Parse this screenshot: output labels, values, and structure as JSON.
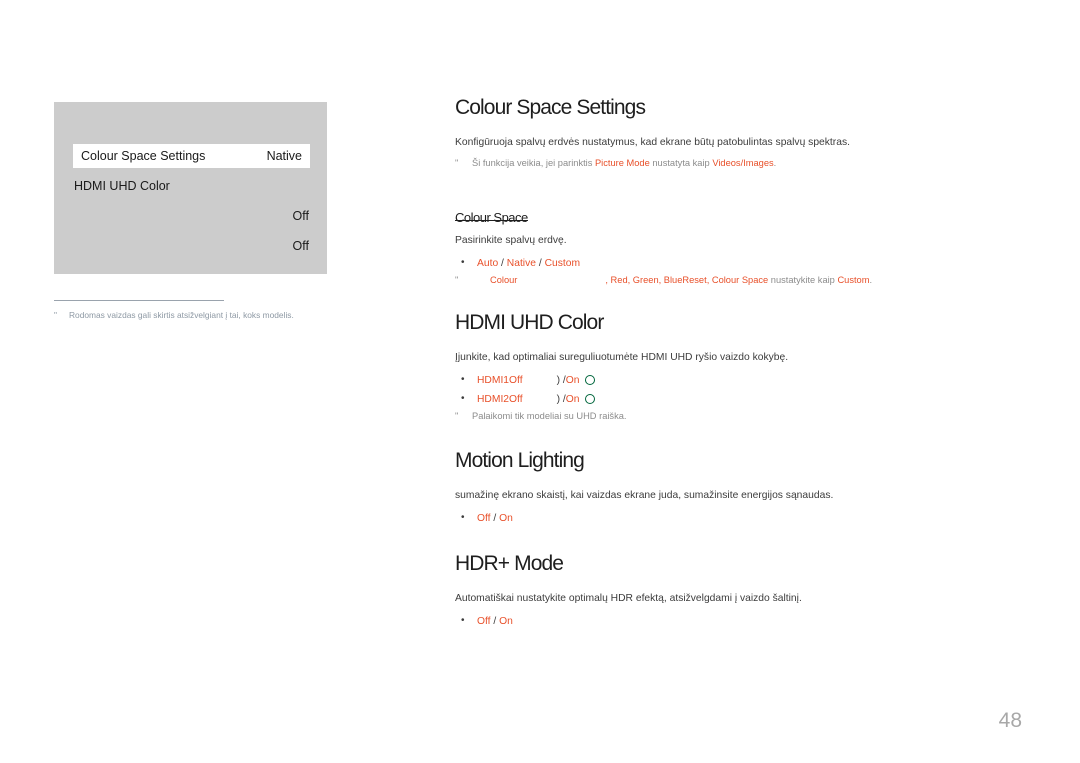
{
  "osd": {
    "rows": [
      {
        "label": "Colour Space Settings",
        "value": "Native",
        "highlight": true
      },
      {
        "label": "HDMI UHD Color",
        "value": "",
        "highlight": false
      },
      {
        "label": "",
        "value": "Off",
        "highlight": false
      },
      {
        "label": "",
        "value": "Off",
        "highlight": false
      }
    ],
    "note_marker": "\"",
    "note_text": "Rodomas vaizdas gali skirtis atsižvelgiant į tai, koks modelis."
  },
  "sections": [
    {
      "title": "Colour Space Settings",
      "desc": "Konfigūruoja spalvų erdvės nustatymus, kad ekrane būtų patobulintas spalvų spektras.",
      "note_marker": "\"",
      "note_pre": "Ši funkcija veikia, jei parinktis ",
      "note_accent1": "Picture Mode",
      "note_mid": " nustatyta kaip ",
      "note_accent2": "Videos/Images",
      "note_post": "."
    },
    {
      "subtitle": "Colour Space",
      "desc": "Pasirinkite spalvų erdvę.",
      "options": [
        {
          "a": "Auto",
          "b": "Native",
          "c": "Custom"
        }
      ],
      "note_marker": "\"",
      "note_accent_colour": "Colour",
      "note_tail_accent": ", Red, Green, Blue",
      "note_tail_accent2": "Reset",
      "note_tail_accent3": ", Colour Space",
      "note_tail_plain": " nustatykite kaip ",
      "note_tail_accent4": "Custom",
      "note_tail_end": "."
    },
    {
      "title": "HDMI UHD Color",
      "desc": "Įjunkite, kad optimaliai sureguliuotumėte HDMI UHD ryšio vaizdo kokybę.",
      "hdmi_options": [
        {
          "name": "HDMI1Off",
          "suffix": ") / ",
          "on": "On"
        },
        {
          "name": "HDMI2Off",
          "suffix": ") / ",
          "on": "On"
        }
      ],
      "note_marker": "\"",
      "note_text": "Palaikomi tik modeliai su UHD raiška."
    },
    {
      "title": "Motion Lighting",
      "desc": "sumažinę ekrano skaistį, kai vaizdas ekrane juda, sumažinsite energijos sąnaudas.",
      "off": "Off",
      "on": "On"
    },
    {
      "title": "HDR+ Mode",
      "desc": "Automatiškai nustatykite optimalų HDR efektą, atsižvelgdami į vaizdo šaltinį.",
      "off": "Off",
      "on": "On"
    }
  ],
  "footer": {
    "page_number": "48"
  },
  "colors": {
    "accent": "#e8502a",
    "ring_green": "#00663c",
    "osd_background": "#cccccc",
    "note_grey": "#8c8c8c",
    "page_number_grey": "#a8a8a8"
  }
}
